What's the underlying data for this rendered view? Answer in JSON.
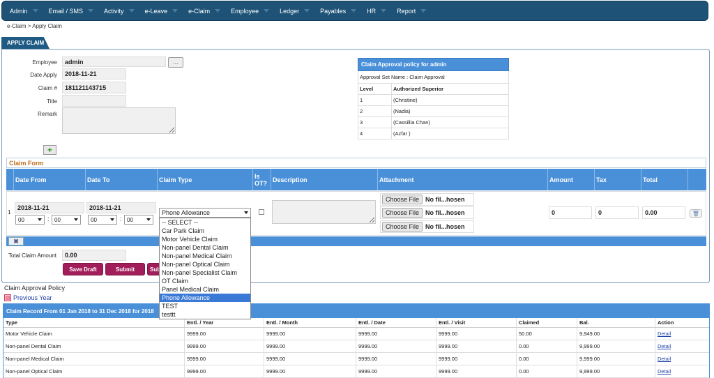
{
  "nav": {
    "items": [
      "Admin",
      "Email / SMS",
      "Activity",
      "e-Leave",
      "e-Claim",
      "Employee",
      "Ledger",
      "Payables",
      "HR",
      "Report"
    ]
  },
  "breadcrumb": "e-Claim > Apply Claim",
  "tab": "APPLY CLAIM",
  "form": {
    "employee_label": "Employee",
    "employee_value": "admin",
    "browse_label": "...",
    "date_apply_label": "Date Apply",
    "date_apply_value": "2018-11-21",
    "claim_no_label": "Claim #",
    "claim_no_value": "181121143715",
    "title_label": "Title",
    "title_value": "",
    "remark_label": "Remark"
  },
  "policy": {
    "header": "Claim Approval policy for admin",
    "set_name": "Approval Set Name : Claim Approval",
    "col_level": "Level",
    "col_superior": "Authorized Superior",
    "rows": [
      {
        "level": "1",
        "superior": "(Christine)"
      },
      {
        "level": "2",
        "superior": "(Nadia)"
      },
      {
        "level": "3",
        "superior": "(Cassillia Chan)"
      },
      {
        "level": "4",
        "superior": "(Azfar )"
      }
    ]
  },
  "claim_form": {
    "title": "Claim Form",
    "headers": [
      "Date From",
      "Date To",
      "Claim Type",
      "Is OT?",
      "Description",
      "Attachment",
      "Amount",
      "Tax",
      "Total"
    ],
    "row": {
      "index": "1",
      "date_from": "2018-11-21",
      "date_to": "2018-11-21",
      "hh": "00",
      "mm": "00",
      "colon": ":",
      "claim_type": "Phone Allowance",
      "choose_file": "Choose File",
      "no_file": "No fil...hosen",
      "amount": "0",
      "tax": "0",
      "total": "0.00"
    },
    "remove_label": "✖",
    "total_label": "Total Claim Amount",
    "total_value": "0.00"
  },
  "dropdown": {
    "options": [
      "-- SELECT --",
      "Car Park Claim",
      "Motor Vehicle Claim",
      "Non-panel Dental Claim",
      "Non-panel Medical Claim",
      "Non-panel Optical Claim",
      "Non-panel Specialist Claim",
      "OT Claim",
      "Panel Medical Claim",
      "Phone Allowance",
      "TEST",
      "testtt"
    ],
    "selected_index": 9
  },
  "buttons": {
    "save_draft": "Save Draft",
    "submit": "Submit",
    "submit2": "Sub"
  },
  "approval_policy_link": "Claim Approval Policy",
  "previous_year": "Previous Year",
  "record": {
    "header": "Claim Record From 01 Jan 2018 to 31 Dec 2018 for 2018",
    "cols": [
      "Type",
      "Entl. / Year",
      "Entl. / Month",
      "Entl. / Date",
      "Entl. / Visit",
      "Claimed",
      "Bal.",
      "Action"
    ],
    "rows": [
      [
        "Motor Vehicle Claim",
        "9999.00",
        "9999.00",
        "9999.00",
        "9999.00",
        "50.00",
        "9,949.00",
        "Detail"
      ],
      [
        "Non-panel Dental Claim",
        "9999.00",
        "9999.00",
        "9999.00",
        "9999.00",
        "0.00",
        "9,999.00",
        "Detail"
      ],
      [
        "Non-panel Medical Claim",
        "9999.00",
        "9999.00",
        "9999.00",
        "9999.00",
        "0.00",
        "9,999.00",
        "Detail"
      ],
      [
        "Non-panel Optical Claim",
        "9999.00",
        "9999.00",
        "9999.00",
        "9999.00",
        "0.00",
        "9,999.00",
        "Detail"
      ]
    ]
  },
  "colors": {
    "nav": "#1e5377",
    "accent": "#4a90d9",
    "button": "#a21e5a",
    "claim_form_title": "#c07020"
  }
}
